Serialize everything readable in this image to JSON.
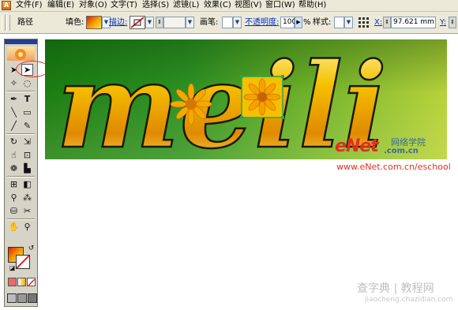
{
  "app": {
    "icon_letter": "A"
  },
  "menu": {
    "items": [
      "文件(F)",
      "编辑(E)",
      "对象(O)",
      "文字(T)",
      "选择(S)",
      "滤镜(L)",
      "效果(C)",
      "视图(V)",
      "窗口(W)",
      "帮助(H)"
    ]
  },
  "control_bar": {
    "object_type": "路径",
    "fill_label": "填色:",
    "stroke_label": "描边:",
    "brush_label": "画笔:",
    "opacity_label": "不透明度:",
    "opacity_value": "100",
    "percent": "%",
    "style_label": "样式:",
    "x_label": "X:",
    "x_value": "97.621 mm",
    "y_label": "Y:"
  },
  "artwork": {
    "text": "meili"
  },
  "watermarks": {
    "enet_logo": "eNet",
    "enet_domain": ".com.cn",
    "enet_cn": "网络学院",
    "enet_url": "www.eNet.com.cn/eschool",
    "site_cn": "查字典 | 教程网",
    "site_url": "jiaocheng.chazidian.com"
  },
  "colors": {
    "menu_bg": "#ece9d8",
    "link": "#0033cc",
    "canvas_dark": "#1c7e14",
    "canvas_light": "#b8d23b",
    "letter_gold": "#f5c000",
    "enet_red": "#e0301e",
    "highlight_circle": "#d8382a"
  },
  "icons": [
    "selection-tool-icon",
    "direct-selection-tool-icon",
    "magic-wand-icon",
    "lasso-icon",
    "pen-tool-icon",
    "type-tool-icon",
    "line-tool-icon",
    "rectangle-tool-icon",
    "paintbrush-icon",
    "pencil-icon",
    "rotate-tool-icon",
    "scale-tool-icon",
    "warp-tool-icon",
    "free-transform-icon",
    "symbol-sprayer-icon",
    "column-graph-icon",
    "mesh-tool-icon",
    "gradient-tool-icon",
    "eyedropper-icon",
    "blend-tool-icon",
    "live-paint-icon",
    "slice-tool-icon",
    "hand-tool-icon",
    "zoom-tool-icon",
    "fill-stroke-swatch",
    "swap-icon",
    "default-colors-icon",
    "screen-mode-icon"
  ]
}
